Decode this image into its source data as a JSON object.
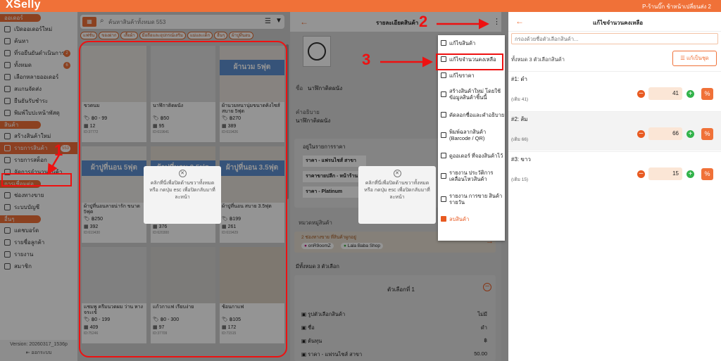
{
  "app": {
    "logo": "XSelly",
    "shop": "P-ร้านบิ๊ก ข้าหน้าเปลี่ยนส่ง 2"
  },
  "sidebar": {
    "s1": "ออเดอร์",
    "items1": [
      {
        "label": "เปิดออเดอร์ใหม่"
      },
      {
        "label": "ค้นหา"
      },
      {
        "label": "ที่รอยืนยันดำเนินการ",
        "badge": "2"
      },
      {
        "label": "ทั้งหมด",
        "badge": "6"
      },
      {
        "label": "เลือกหลายออเดอร์"
      },
      {
        "label": "สแกนจัดส่ง"
      },
      {
        "label": "ยืนยันรับชำระ"
      },
      {
        "label": "พิมพ์ใบปะหน้าพัสดุ"
      }
    ],
    "s2": "สินค้า",
    "items2": [
      {
        "label": "สร้างสินค้าใหม่"
      },
      {
        "label": "รายการสินค้า",
        "badge": "553"
      },
      {
        "label": "รายการสต็อก"
      },
      {
        "label": "จัดการจำนวนสินค้า"
      }
    ],
    "s3": "การเชื่อมต่อ",
    "items3": [
      {
        "label": "ช่องทางขาย"
      },
      {
        "label": "ระบบบัญชี"
      }
    ],
    "s4": "อื่นๆ",
    "items4": [
      {
        "label": "แดชบอร์ด"
      },
      {
        "label": "รายชื่อลูกค้า"
      },
      {
        "label": "รายงาน"
      },
      {
        "label": "สมาชิก"
      }
    ],
    "version": "Version: 20260317_1536p",
    "logout": "ออกระบบ"
  },
  "list": {
    "search_placeholder": "ค้นหาสินค้าทั้งหมด 553",
    "chips": [
      "แฟชั่น",
      "ของฝาก",
      "เสื้อผ้า",
      "มือถือและอุปกรณ์เสริม",
      "แม่และเด็ก",
      "อื่นๆ",
      "ผ้าปูที่นอน"
    ],
    "products": [
      {
        "name": "ขวดนม",
        "price": "฿0 - 99",
        "stock": "12",
        "id": "ID:37772",
        "banner": ""
      },
      {
        "name": "นาฬิกาติดผนัง",
        "price": "฿50",
        "stock": "95",
        "id": "ID:619641",
        "banner": ""
      },
      {
        "name": "ผ้านวมหนานุ่มขนาดคิงไซส์ สบาย 5ฟุต",
        "price": "฿270",
        "stock": "389",
        "id": "ID:619426",
        "banner": "ผ้านวม 5ฟุต"
      },
      {
        "name": "ผ้าปูที่นอนลายน่ารัก ขนาด 5ฟุต",
        "price": "฿250",
        "stock": "392",
        "id": "ID:619430",
        "banner": "ผ้าปูที่นอน 5ฟุต"
      },
      {
        "name": "ผ้าปูที่นอน 3.5ฟุต",
        "price": "฿270",
        "stock": "376",
        "id": "ID:620300",
        "banner": "ผ้าปูที่นอน 3.5ฟุต"
      },
      {
        "name": "ผ้าปูที่นอน สบาย 3.5ฟุต",
        "price": "฿199",
        "stock": "261",
        "id": "ID:619429",
        "banner": "ผ้าปูที่นอน 3.5ฟุต"
      },
      {
        "name": "แชมพู ครีมนวดผม ว่าน หางจระเข้",
        "price": "฿0 - 199",
        "stock": "409",
        "id": "ID:75246",
        "banner": ""
      },
      {
        "name": "แก้วกาแฟ เรียบง่าย",
        "price": "฿0 - 300",
        "stock": "97",
        "id": "ID:37709",
        "banner": ""
      },
      {
        "name": "ช้อนกาแฟ",
        "price": "฿105",
        "stock": "172",
        "id": "ID:71515",
        "banner": ""
      }
    ],
    "popup_text": "คลิกที่นี่เพื่อปิดด้านขวาทั้งหมด หรือ กดปุ่ม esc เพื่อปิดกลับมาที่ละหน้า"
  },
  "detail": {
    "title": "รายละเอียดสินค้า",
    "name_label": "ชื่อ",
    "name_value": "นาฬิกาติดผนัง",
    "desc_label": "คำอธิบาย",
    "desc_value": "นาฬิกาติดผนัง",
    "price_section": "อยู่ในรายการราคา",
    "prices": [
      "ราคา - แฟรนไชส์ สาขา",
      "ราคาขายปลีก - หน้าร้าน",
      "ราคา - Platinum"
    ],
    "category_label": "หมวดหมู่สินค้า",
    "channel_note": "2 ช่องทางขาย ที่สินค้าผูกอยู่",
    "channels": [
      "onR9oomZ",
      "Lala Baba Shop"
    ],
    "variant_count": "มีทั้งหมด 3 ตัวเลือก",
    "variant_title": "ตัวเลือกที่ 1",
    "rows": [
      {
        "k": "รูปตัวเลือกสินค้า",
        "v": "ไม่มี"
      },
      {
        "k": "ชื่อ",
        "v": "ดำ"
      },
      {
        "k": "ต้นทุน",
        "v": "฿"
      },
      {
        "k": "ราคา - แฟรนไชส์ สาขา",
        "v": "50.00"
      }
    ]
  },
  "menu": [
    {
      "label": "แก้ไขสินค้า"
    },
    {
      "label": "แก้ไขจำนวนคงเหลือ"
    },
    {
      "label": "แก้ไขราคา"
    },
    {
      "label": "สร้างสินค้าใหม่ โดยใช้ข้อมูลสินค้าชิ้นนี้"
    },
    {
      "label": "คัดลอกชื่อและคำอธิบาย"
    },
    {
      "label": "พิมพ์ฉลากสินค้า (Barcode / QR)"
    },
    {
      "label": "ดูออเดอร์ ที่จองสินค้าไว้"
    },
    {
      "label": "รายงาน ประวัติการ เคลื่อนไหวสินค้า"
    },
    {
      "label": "รายงาน การขาย สินค้ารายวัน"
    },
    {
      "label": "ลบสินค้า"
    }
  ],
  "stock": {
    "title": "แก้ไขจำนวนคงเหลือ",
    "filter_placeholder": "กรองด้วยชื่อตัวเลือกสินค้า...",
    "count": "ทั้งหมด 3 ตัวเลือกสินค้า",
    "batch": "แก้เป็นชุด",
    "options": [
      {
        "no": "#1:",
        "name": "ดำ",
        "was": "(เดิม 41)",
        "qty": "41"
      },
      {
        "no": "#2:",
        "name": "ส้ม",
        "was": "(เดิม 66)",
        "qty": "66"
      },
      {
        "no": "#3:",
        "name": "ขาว",
        "was": "(เดิม 15)",
        "qty": "15"
      }
    ]
  },
  "annotations": [
    "1",
    "2",
    "3"
  ],
  "colors": {
    "brand": "#f07138",
    "annotation": "#e11111"
  }
}
